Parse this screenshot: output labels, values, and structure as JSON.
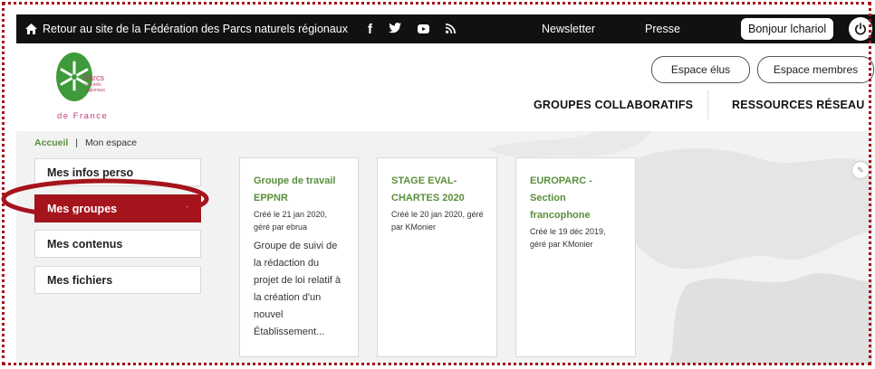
{
  "topbar": {
    "home_link": "Retour au site de la Fédération des Parcs naturels régionaux",
    "social": [
      "facebook-icon",
      "twitter-icon",
      "youtube-icon",
      "rss-icon"
    ],
    "newsletter": "Newsletter",
    "presse": "Presse",
    "user_greeting": "Bonjour lchariol"
  },
  "logo": {
    "line1": "Parcs",
    "line2": "naturels",
    "line3": "régionaux",
    "line4": "de France"
  },
  "header": {
    "espace_elus": "Espace élus",
    "espace_membres": "Espace membres",
    "nav": [
      "GROUPES COLLABORATIFS",
      "RESSOURCES RÉSEAU"
    ]
  },
  "breadcrumb": {
    "home": "Accueil",
    "separator": "|",
    "current": "Mon espace"
  },
  "sidebar": {
    "items": [
      {
        "label": "Mes infos perso"
      },
      {
        "label": "Mes groupes"
      },
      {
        "label": "Mes contenus"
      },
      {
        "label": "Mes fichiers"
      }
    ]
  },
  "cards": [
    {
      "title": "Groupe de travail EPPNR",
      "meta": "Créé le 21 jan 2020, géré par ebrua",
      "description": "Groupe de suivi de la rédaction du projet de loi relatif à la création d'un nouvel Établissement..."
    },
    {
      "title": "STAGE EVAL-CHARTES 2020",
      "meta": "Créé le 20 jan 2020, géré par KMonier",
      "description": ""
    },
    {
      "title": "EUROPARC - Section francophone",
      "meta": "Créé le 19 déc 2019, géré par KMonier",
      "description": ""
    }
  ],
  "colors": {
    "accent_red": "#a5141c",
    "link_green": "#5a8f3a",
    "topbar_bg": "#111111"
  }
}
